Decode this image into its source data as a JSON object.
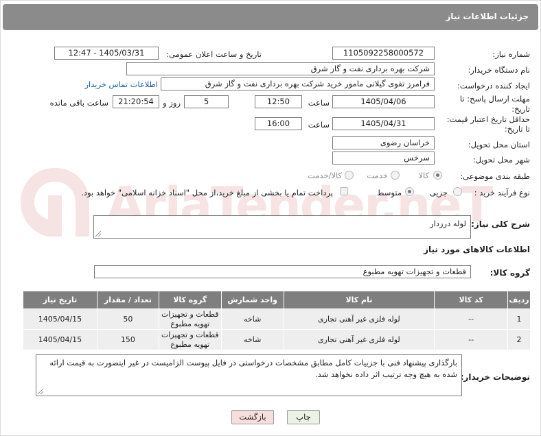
{
  "header": {
    "title": "جزئیات اطلاعات نیاز"
  },
  "watermark": {
    "text": "AriaTender.neT"
  },
  "fields": {
    "need_number_label": "شماره نیاز:",
    "need_number": "1105092258000572",
    "announce_label": "تاریخ و ساعت اعلان عمومی:",
    "announce_value": "1405/03/31 - 12:47",
    "buyer_org_label": "نام دستگاه خریدار:",
    "buyer_org": "شرکت بهره برداری نفت و گاز شرق",
    "requester_label": "ایجاد کننده درخواست:",
    "requester": "فرامرز تقوی گیلانی مامور خرید شرکت بهره برداری نفت و گاز شرق",
    "buyer_contact_link": "اطلاعات تماس خریدار",
    "deadline_label_1": "مهلت ارسال پاسخ: تا",
    "deadline_label_2": "تاریخ:",
    "deadline_date": "1405/04/06",
    "time_word": "ساعت",
    "deadline_time": "12:50",
    "days_value": "5",
    "days_word": "روز و",
    "remaining_time": "21:20:54",
    "remaining_word": "ساعت باقی مانده",
    "price_validity_label_1": "حداقل تاریخ اعتبار قیمت:",
    "price_validity_label_2": "تا تاریخ:",
    "price_validity_date": "1405/04/31",
    "price_validity_time": "16:00",
    "province_label": "استان محل تحویل:",
    "province": "خراسان رضوی",
    "city_label": "شهر محل تحویل:",
    "city": "سرخس",
    "category_label": "طبقه بندی موضوعی:",
    "category_options": [
      "کالا",
      "خدمت",
      "کالا/خدمت"
    ],
    "process_label": "نوع فرآیند خرید :",
    "process_options": [
      "جزیی",
      "متوسط"
    ],
    "payment_note": "پرداخت تمام یا بخشی از مبلغ خرید،از محل \"اسناد خزانه اسلامی\" خواهد بود.",
    "summary_label": "شرح کلی نیاز:",
    "summary": "لوله درزدار",
    "goods_info_label": "اطلاعات کالاهای مورد نیاز",
    "goods_group_label": "گروه کالا:",
    "goods_group": "قطعات و تجهیزات تهویه مطبوع",
    "buyer_notes_label": "توضیحات خریدار:",
    "buyer_notes": "بارگذاری پیشنهاد فنی با جزییات کامل مطابق مشخصات درخواستی در فایل پیوست الزامیست در غیر اینصورت به قیمت ارائه شده به هیچ وجه ترتیب اثر داده نخواهد شد."
  },
  "table": {
    "headers": [
      "ردیف",
      "کد کالا",
      "نام کالا",
      "واحد شمارش",
      "گروه کالا",
      "تعداد / مقدار",
      "تاریخ نیاز"
    ],
    "rows": [
      [
        "1",
        "--",
        "لوله فلزی غیر آهنی تجاری",
        "شاخه",
        "قطعات و تجهیزات تهویه مطبوع",
        "50",
        "1405/04/15"
      ],
      [
        "2",
        "--",
        "لوله فلزی غیر آهنی تجاری",
        "شاخه",
        "قطعات و تجهیزات تهویه مطبوع",
        "150",
        "1405/04/15"
      ]
    ]
  },
  "buttons": {
    "print": "چاپ",
    "back": "بازگشت"
  }
}
